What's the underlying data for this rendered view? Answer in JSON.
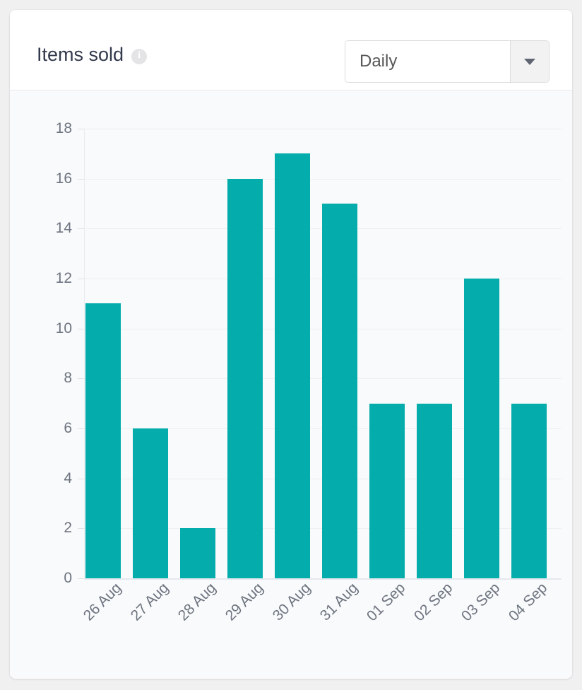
{
  "card": {
    "header": {
      "title": "Items sold",
      "info_icon": "info-icon",
      "info_glyph": "i"
    },
    "period_select": {
      "selected": "Daily",
      "arrow_icon": "chevron-down-icon"
    }
  },
  "colors": {
    "bar": "#04acab",
    "plot_background": "#f9fafb",
    "card_background": "#ffffff",
    "page_background": "#f0f0f0",
    "gridline": "#edeff2",
    "tick_label": "#6d7480",
    "title": "#32394c"
  },
  "chart_data": {
    "type": "bar",
    "title": "Items sold",
    "xlabel": "",
    "ylabel": "",
    "categories": [
      "26 Aug",
      "27 Aug",
      "28 Aug",
      "29 Aug",
      "30 Aug",
      "31 Aug",
      "01 Sep",
      "02 Sep",
      "03 Sep",
      "04 Sep"
    ],
    "values": [
      11,
      6,
      2,
      16,
      17,
      15,
      7,
      7,
      12,
      7
    ],
    "ylim": [
      0,
      18
    ],
    "yticks": [
      0,
      2,
      4,
      6,
      8,
      10,
      12,
      14,
      16,
      18
    ],
    "grid": true,
    "legend": false,
    "series": [
      {
        "name": "Items sold",
        "color": "#04acab",
        "values": [
          11,
          6,
          2,
          16,
          17,
          15,
          7,
          7,
          12,
          7
        ]
      }
    ]
  }
}
